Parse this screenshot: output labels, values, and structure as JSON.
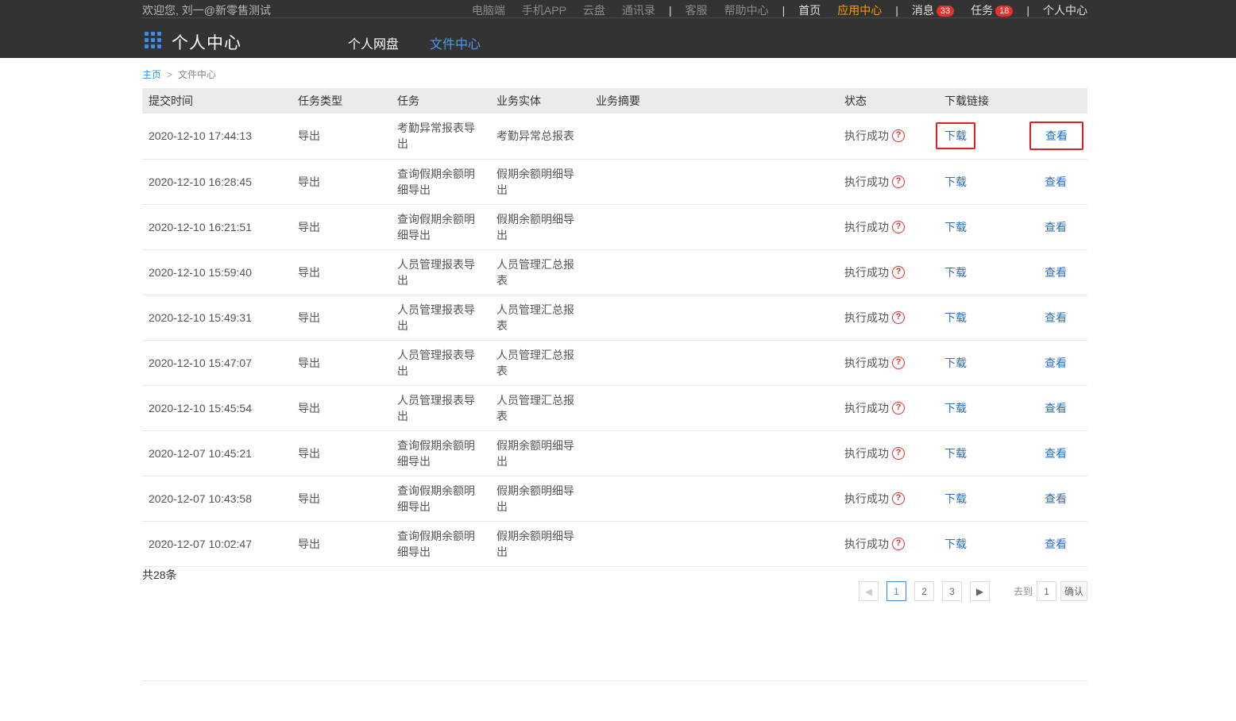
{
  "header": {
    "welcome": "欢迎您, 刘一@新零售测试",
    "util_links": {
      "desktop": "电脑端",
      "mobile_app": "手机APP",
      "cloud": "云盘",
      "contacts": "通讯录",
      "service": "客服",
      "help": "帮助中心",
      "home": "首页",
      "app_center": "应用中心",
      "messages": "消息",
      "messages_count": "33",
      "tasks": "任务",
      "tasks_count": "18",
      "personal_center": "个人中心",
      "separator": "|"
    },
    "app_title": "个人中心",
    "nav": {
      "disk": "个人网盘",
      "files": "文件中心"
    }
  },
  "breadcrumb": {
    "home": "主页",
    "arrow": ">",
    "current": "文件中心"
  },
  "table": {
    "headers": {
      "time": "提交时间",
      "type": "任务类型",
      "task": "任务",
      "entity": "业务实体",
      "summary": "业务摘要",
      "status": "状态",
      "link": "下载链接"
    },
    "rows": [
      {
        "time": "2020-12-10 17:44:13",
        "type": "导出",
        "task": "考勤异常报表导出",
        "entity": "考勤异常总报表",
        "status": "执行成功",
        "download": "下载",
        "view": "查看"
      },
      {
        "time": "2020-12-10 16:28:45",
        "type": "导出",
        "task": "查询假期余额明细导出",
        "entity": "假期余额明细导出",
        "status": "执行成功",
        "download": "下载",
        "view": "查看"
      },
      {
        "time": "2020-12-10 16:21:51",
        "type": "导出",
        "task": "查询假期余额明细导出",
        "entity": "假期余额明细导出",
        "status": "执行成功",
        "download": "下载",
        "view": "查看"
      },
      {
        "time": "2020-12-10 15:59:40",
        "type": "导出",
        "task": "人员管理报表导出",
        "entity": "人员管理汇总报表",
        "status": "执行成功",
        "download": "下载",
        "view": "查看"
      },
      {
        "time": "2020-12-10 15:49:31",
        "type": "导出",
        "task": "人员管理报表导出",
        "entity": "人员管理汇总报表",
        "status": "执行成功",
        "download": "下载",
        "view": "查看"
      },
      {
        "time": "2020-12-10 15:47:07",
        "type": "导出",
        "task": "人员管理报表导出",
        "entity": "人员管理汇总报表",
        "status": "执行成功",
        "download": "下载",
        "view": "查看"
      },
      {
        "time": "2020-12-10 15:45:54",
        "type": "导出",
        "task": "人员管理报表导出",
        "entity": "人员管理汇总报表",
        "status": "执行成功",
        "download": "下载",
        "view": "查看"
      },
      {
        "time": "2020-12-07 10:45:21",
        "type": "导出",
        "task": "查询假期余额明细导出",
        "entity": "假期余额明细导出",
        "status": "执行成功",
        "download": "下载",
        "view": "查看"
      },
      {
        "time": "2020-12-07 10:43:58",
        "type": "导出",
        "task": "查询假期余额明细导出",
        "entity": "假期余额明细导出",
        "status": "执行成功",
        "download": "下载",
        "view": "查看"
      },
      {
        "time": "2020-12-07 10:02:47",
        "type": "导出",
        "task": "查询假期余额明细导出",
        "entity": "假期余额明细导出",
        "status": "执行成功",
        "download": "下载",
        "view": "查看"
      }
    ]
  },
  "footer": {
    "total": "共28条"
  },
  "pagination": {
    "pages": [
      "1",
      "2",
      "3"
    ],
    "current_page": "1",
    "goto_label": "去到",
    "goto_value": "1",
    "confirm": "确认"
  },
  "icons": {
    "help": "?",
    "prev": "◀",
    "next": "▶"
  },
  "colors": {
    "topbar": "#333333",
    "accent": "#3d8de6",
    "active_orange": "#ff9900",
    "badge": "#e6312f",
    "highlight_box": "#e01f1f"
  }
}
